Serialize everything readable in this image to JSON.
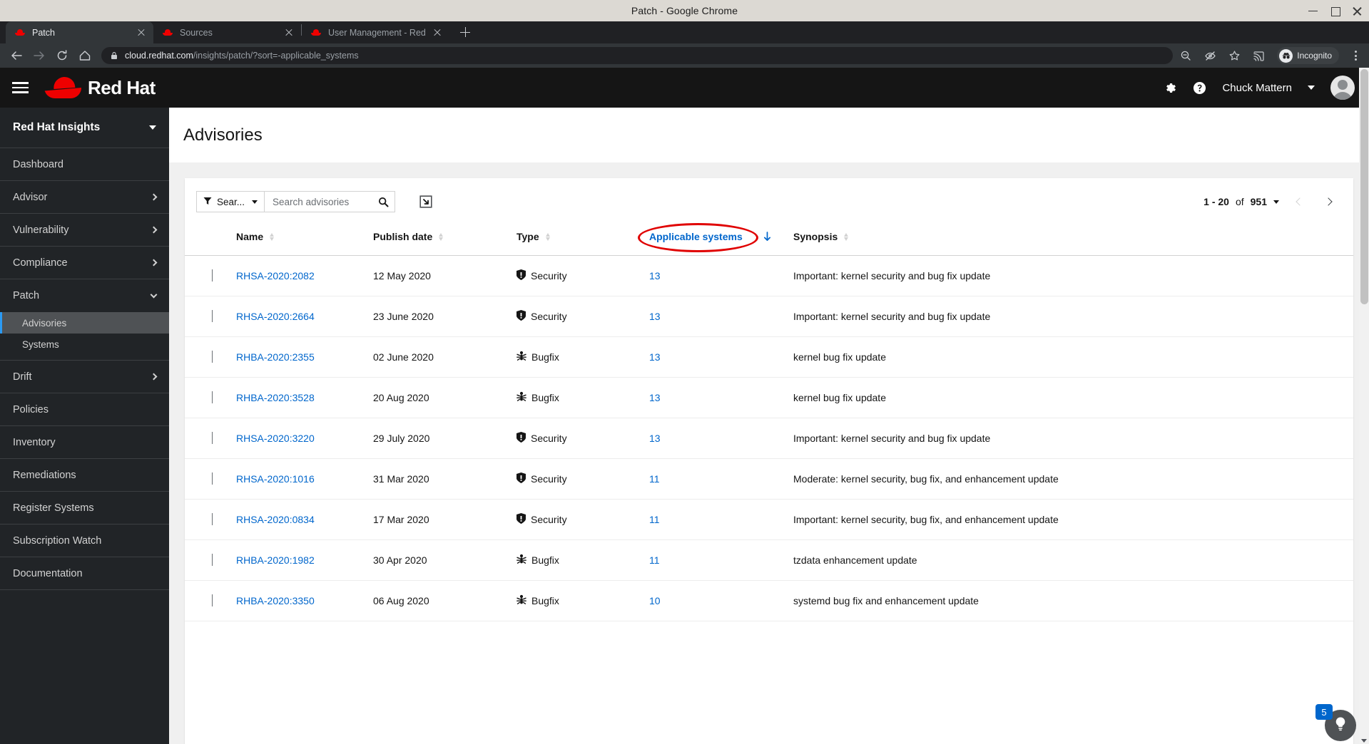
{
  "window": {
    "title": "Patch - Google Chrome",
    "minimize_label": "Minimize",
    "maximize_label": "Maximize",
    "close_label": "Close"
  },
  "browser": {
    "tabs": [
      {
        "label": "Patch",
        "active": true
      },
      {
        "label": "Sources",
        "active": false
      },
      {
        "label": "User Management - Red",
        "active": false
      }
    ],
    "new_tab_label": "+",
    "url_host": "cloud.redhat.com",
    "url_path": "/insights/patch/?sort=-applicable_systems",
    "profile_label": "Incognito",
    "icons": {
      "back": "back-arrow-icon",
      "forward": "forward-arrow-icon",
      "reload": "reload-icon",
      "home": "home-icon",
      "lock": "lock-icon",
      "zoom_out": "zoom-out-icon",
      "tracking_blocked": "eye-slash-icon",
      "bookmark": "star-icon",
      "cast": "cast-icon",
      "menu": "kebab-menu-icon"
    }
  },
  "masthead": {
    "brand": "Red Hat",
    "username": "Chuck Mattern",
    "settings_label": "Settings",
    "help_label": "Help"
  },
  "sidebar": {
    "brand": "Red Hat Insights",
    "items": [
      {
        "label": "Dashboard",
        "expandable": false
      },
      {
        "label": "Advisor",
        "expandable": true
      },
      {
        "label": "Vulnerability",
        "expandable": true
      },
      {
        "label": "Compliance",
        "expandable": true
      },
      {
        "label": "Patch",
        "expandable": true,
        "expanded": true,
        "children": [
          {
            "label": "Advisories",
            "active": true
          },
          {
            "label": "Systems",
            "active": false
          }
        ]
      },
      {
        "label": "Drift",
        "expandable": true
      },
      {
        "label": "Policies",
        "expandable": false
      },
      {
        "label": "Inventory",
        "expandable": false
      },
      {
        "label": "Remediations",
        "expandable": false
      },
      {
        "label": "Register Systems",
        "expandable": false
      },
      {
        "label": "Subscription Watch",
        "expandable": false
      },
      {
        "label": "Documentation",
        "expandable": false
      }
    ]
  },
  "main": {
    "page_title": "Advisories",
    "toolbar": {
      "filter_label": "Sear...",
      "search_placeholder": "Search advisories",
      "search_value": "",
      "export_label": "Export"
    },
    "pagination": {
      "range": "1 - 20",
      "of_label": "of",
      "total": "951",
      "prev_label": "Previous page",
      "next_label": "Next page"
    },
    "table": {
      "columns": [
        {
          "label": "Name",
          "sorted": false
        },
        {
          "label": "Publish date",
          "sorted": false
        },
        {
          "label": "Type",
          "sorted": false
        },
        {
          "label": "Applicable systems",
          "sorted": true,
          "sort_dir": "desc",
          "highlighted": true
        },
        {
          "label": "Synopsis",
          "sorted": false
        }
      ],
      "rows": [
        {
          "name": "RHSA-2020:2082",
          "date": "12 May 2020",
          "type": "Security",
          "type_icon": "shield-icon",
          "applicable": "13",
          "synopsis": "Important: kernel security and bug fix update"
        },
        {
          "name": "RHSA-2020:2664",
          "date": "23 June 2020",
          "type": "Security",
          "type_icon": "shield-icon",
          "applicable": "13",
          "synopsis": "Important: kernel security and bug fix update"
        },
        {
          "name": "RHBA-2020:2355",
          "date": "02 June 2020",
          "type": "Bugfix",
          "type_icon": "bug-icon",
          "applicable": "13",
          "synopsis": "kernel bug fix update"
        },
        {
          "name": "RHBA-2020:3528",
          "date": "20 Aug 2020",
          "type": "Bugfix",
          "type_icon": "bug-icon",
          "applicable": "13",
          "synopsis": "kernel bug fix update"
        },
        {
          "name": "RHSA-2020:3220",
          "date": "29 July 2020",
          "type": "Security",
          "type_icon": "shield-icon",
          "applicable": "13",
          "synopsis": "Important: kernel security and bug fix update"
        },
        {
          "name": "RHSA-2020:1016",
          "date": "31 Mar 2020",
          "type": "Security",
          "type_icon": "shield-icon",
          "applicable": "11",
          "synopsis": "Moderate: kernel security, bug fix, and enhancement update"
        },
        {
          "name": "RHSA-2020:0834",
          "date": "17 Mar 2020",
          "type": "Security",
          "type_icon": "shield-icon",
          "applicable": "11",
          "synopsis": "Important: kernel security, bug fix, and enhancement update"
        },
        {
          "name": "RHBA-2020:1982",
          "date": "30 Apr 2020",
          "type": "Bugfix",
          "type_icon": "bug-icon",
          "applicable": "11",
          "synopsis": "tzdata enhancement update"
        },
        {
          "name": "RHBA-2020:3350",
          "date": "06 Aug 2020",
          "type": "Bugfix",
          "type_icon": "bug-icon",
          "applicable": "10",
          "synopsis": "systemd bug fix and enhancement update"
        }
      ]
    },
    "help_widget": {
      "badge_count": "5",
      "label": "Help and support"
    }
  },
  "colors": {
    "brand_red": "#ee0000",
    "link_blue": "#0066cc",
    "annotation_red": "#e00000",
    "active_nav": "#2b9af3",
    "badge_blue": "#0066cc"
  }
}
